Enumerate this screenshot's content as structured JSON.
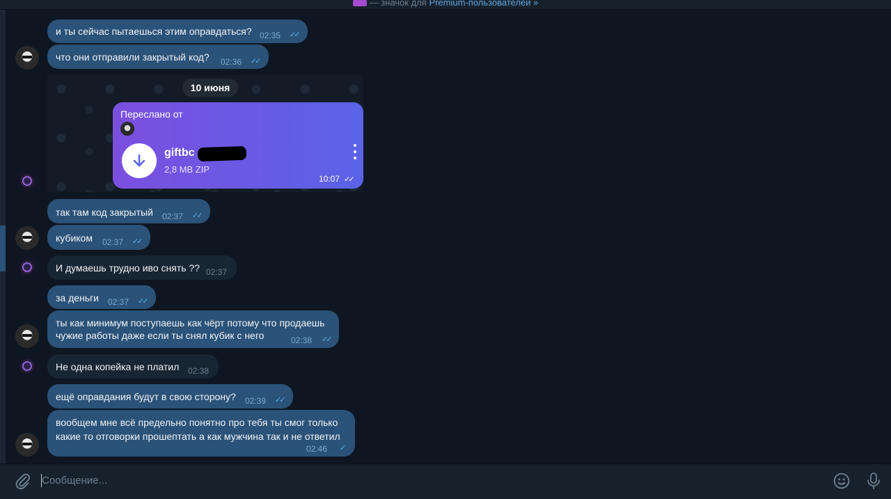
{
  "topbar": {
    "prefix": "— значок для ",
    "link": "Premium-пользователей »"
  },
  "chat": {
    "date_separator": "10 июня",
    "messages": [
      {
        "text": "и ты сейчас пытаешься этим оправдаться?",
        "time": "02:35",
        "dir": "out",
        "status": "read"
      },
      {
        "text": "что они отправили закрытый код?",
        "time": "02:36",
        "dir": "out",
        "status": "read"
      },
      {
        "text": "так там код закрытый",
        "time": "02:37",
        "dir": "out",
        "status": "read"
      },
      {
        "text": "кубиком",
        "time": "02:37",
        "dir": "out",
        "status": "read"
      },
      {
        "text": "И думаешь трудно иво снять ??",
        "time": "02:37",
        "dir": "in"
      },
      {
        "text": "за деньги",
        "time": "02:37",
        "dir": "out",
        "status": "read"
      },
      {
        "line1": "ты как минимум поступаешь как чёрт потому что продаешь",
        "line2": "чужие работы даже если ты снял кубик с него",
        "time": "02:38",
        "dir": "out",
        "status": "read"
      },
      {
        "text": "Не одна копейка не платил",
        "time": "02:38",
        "dir": "in"
      },
      {
        "text": "ещё оправдания будут в свою сторону?",
        "time": "02:39",
        "dir": "out",
        "status": "read"
      },
      {
        "line1": "вообщем мне всё предельно понятно про тебя ты смог только",
        "line2": "какие то отговорки прошептать а как мужчина так и не ответил",
        "time": "02:46",
        "dir": "out",
        "status": "sent"
      }
    ],
    "forwarded": {
      "label": "Переслано от",
      "file_name": "giftbc",
      "file_size": "2,8 MB ZIP",
      "time": "10:07",
      "status": "read"
    }
  },
  "composer": {
    "placeholder": "Сообщение..."
  },
  "icons": {
    "attach": "paperclip-icon",
    "emoji": "emoji-icon",
    "mic": "microphone-icon",
    "download": "download-icon",
    "menu": "more-vertical-icon"
  },
  "colors": {
    "background": "#0e1621",
    "outgoing": "#2b5278",
    "incoming": "#182533",
    "forward_gradient_start": "#7b4fe0",
    "forward_gradient_end": "#5a63e6"
  }
}
